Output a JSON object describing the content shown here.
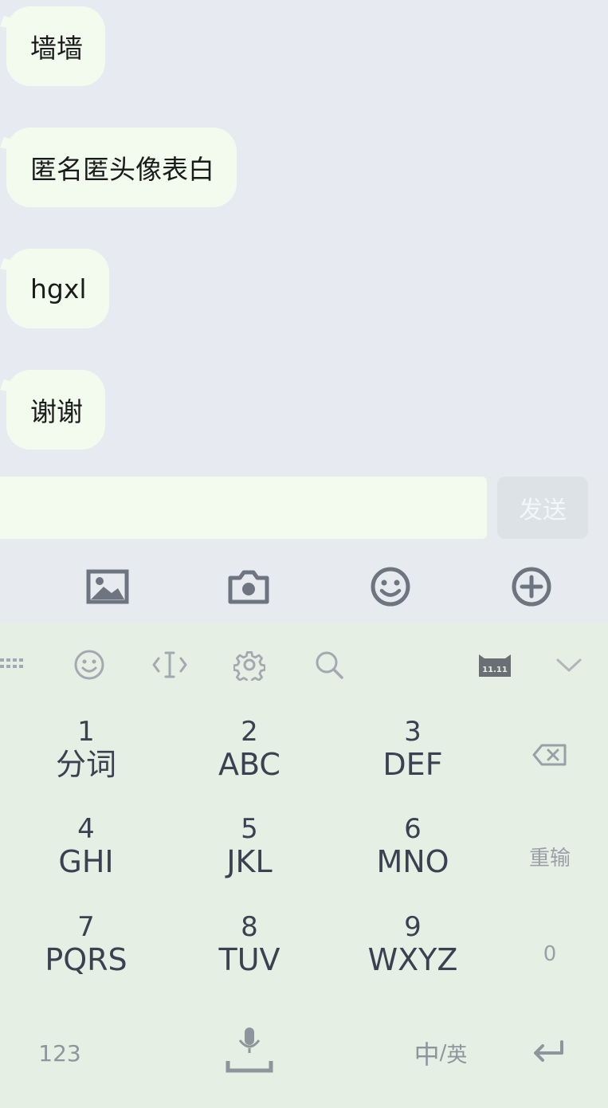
{
  "messages": [
    {
      "text": "墙墙"
    },
    {
      "text": "匿名匿头像表白"
    },
    {
      "text": "hgxl"
    },
    {
      "text": "谢谢"
    }
  ],
  "composer": {
    "input_value": "",
    "send_label": "发送"
  },
  "toolbar": {
    "icons": [
      "image-icon",
      "camera-icon",
      "emoji-icon",
      "plus-icon"
    ]
  },
  "keyboard": {
    "top_icons": [
      "keyboard-switch-icon",
      "emoji-icon",
      "cursor-icon",
      "settings-icon",
      "search-icon",
      "cat-11-11-icon",
      "collapse-icon"
    ],
    "cat_badge": "11.11",
    "keys": [
      {
        "num": "1",
        "letters": "分词"
      },
      {
        "num": "2",
        "letters": "ABC"
      },
      {
        "num": "3",
        "letters": "DEF"
      },
      {
        "num": "4",
        "letters": "GHI"
      },
      {
        "num": "5",
        "letters": "JKL"
      },
      {
        "num": "6",
        "letters": "MNO"
      },
      {
        "num": "7",
        "letters": "PQRS"
      },
      {
        "num": "8",
        "letters": "TUV"
      },
      {
        "num": "9",
        "letters": "WXYZ"
      }
    ],
    "side": {
      "reinput_label": "重输",
      "zero_label": "0"
    },
    "bottom": {
      "numbers_label": "123",
      "lang_main": "中",
      "lang_sep": "/",
      "lang_alt": "英"
    }
  },
  "colors": {
    "chat_bg": "#e7ebf1",
    "bubble_bg": "#f3fbef",
    "keyboard_bg": "#e6efe4",
    "icon_gray": "#6e7480"
  }
}
